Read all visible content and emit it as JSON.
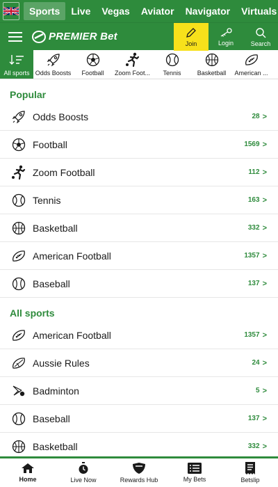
{
  "topnav": {
    "flag_icon": "uk-flag-icon",
    "items": [
      {
        "label": "Sports",
        "active": true
      },
      {
        "label": "Live"
      },
      {
        "label": "Vegas"
      },
      {
        "label": "Aviator"
      },
      {
        "label": "Navigator"
      },
      {
        "label": "Virtuals"
      }
    ]
  },
  "header": {
    "brand": "PREMIER Bet",
    "join": "Join",
    "login": "Login",
    "search": "Search"
  },
  "tabs": [
    {
      "label": "All sports",
      "icon": "sort-icon",
      "active": true
    },
    {
      "label": "Odds Boosts",
      "icon": "rocket-icon"
    },
    {
      "label": "Football",
      "icon": "soccer-ball-icon"
    },
    {
      "label": "Zoom Foot...",
      "icon": "kicking-player-icon"
    },
    {
      "label": "Tennis",
      "icon": "tennis-ball-icon"
    },
    {
      "label": "Basketball",
      "icon": "basketball-icon"
    },
    {
      "label": "American ...",
      "icon": "american-football-icon"
    }
  ],
  "popular": {
    "title": "Popular",
    "rows": [
      {
        "label": "Odds Boosts",
        "count": "28",
        "icon": "rocket-icon"
      },
      {
        "label": "Football",
        "count": "1569",
        "icon": "soccer-ball-icon"
      },
      {
        "label": "Zoom Football",
        "count": "112",
        "icon": "kicking-player-icon"
      },
      {
        "label": "Tennis",
        "count": "163",
        "icon": "tennis-ball-icon"
      },
      {
        "label": "Basketball",
        "count": "332",
        "icon": "basketball-icon"
      },
      {
        "label": "American Football",
        "count": "1357",
        "icon": "american-football-icon"
      },
      {
        "label": "Baseball",
        "count": "137",
        "icon": "baseball-icon"
      }
    ]
  },
  "all_sports": {
    "title": "All sports",
    "rows": [
      {
        "label": "American Football",
        "count": "1357",
        "icon": "american-football-icon"
      },
      {
        "label": "Aussie Rules",
        "count": "24",
        "icon": "aussie-rules-ball-icon"
      },
      {
        "label": "Badminton",
        "count": "5",
        "icon": "shuttlecock-icon"
      },
      {
        "label": "Baseball",
        "count": "137",
        "icon": "baseball-icon"
      },
      {
        "label": "Basketball",
        "count": "332",
        "icon": "basketball-icon"
      }
    ]
  },
  "chevron": ">",
  "bottomnav": [
    {
      "label": "Home",
      "icon": "home-icon",
      "active": true
    },
    {
      "label": "Live Now",
      "icon": "stopwatch-icon"
    },
    {
      "label": "Rewards Hub",
      "icon": "shield-icon"
    },
    {
      "label": "My Bets",
      "icon": "list-icon"
    },
    {
      "label": "Betslip",
      "icon": "receipt-icon"
    }
  ],
  "colors": {
    "brand_green": "#2e8b3c",
    "join_yellow": "#f7e11b"
  }
}
